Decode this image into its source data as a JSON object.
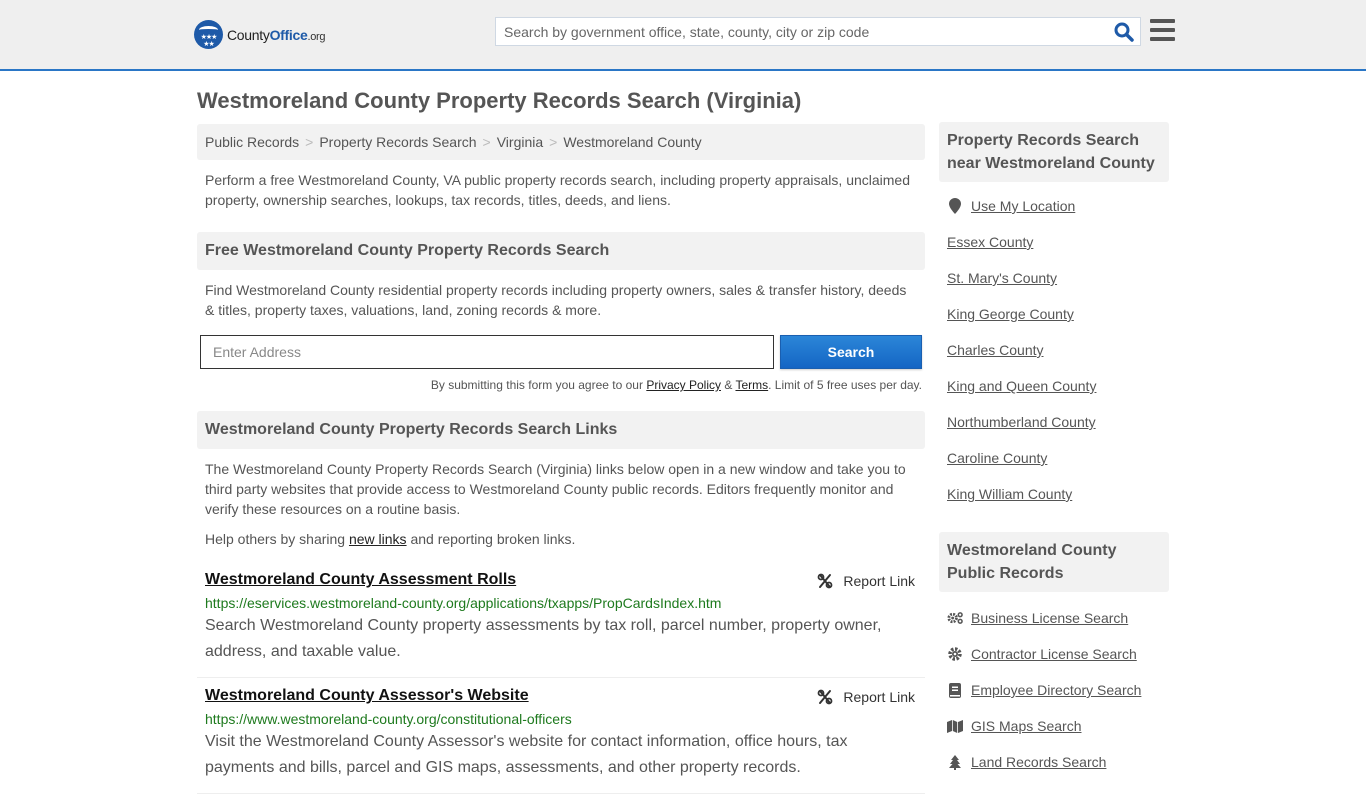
{
  "header": {
    "logo": {
      "county": "County",
      "office": "Office",
      "org": ".org"
    },
    "search_placeholder": "Search by government office, state, county, city or zip code"
  },
  "page_title": "Westmoreland County Property Records Search (Virginia)",
  "breadcrumb": [
    "Public Records",
    "Property Records Search",
    "Virginia",
    "Westmoreland County"
  ],
  "intro": "Perform a free Westmoreland County, VA public property records search, including property appraisals, unclaimed property, ownership searches, lookups, tax records, titles, deeds, and liens.",
  "free_search": {
    "heading": "Free Westmoreland County Property Records Search",
    "description": "Find Westmoreland County residential property records including property owners, sales & transfer history, deeds & titles, property taxes, valuations, land, zoning records & more.",
    "address_placeholder": "Enter Address",
    "button": "Search",
    "terms_prefix": "By submitting this form you agree to our ",
    "privacy_link": "Privacy Policy",
    "amp": " & ",
    "terms_link": "Terms",
    "terms_suffix": ". Limit of 5 free uses per day."
  },
  "links_section": {
    "heading": "Westmoreland County Property Records Search Links",
    "description": "The Westmoreland County Property Records Search (Virginia) links below open in a new window and take you to third party websites that provide access to Westmoreland County public records. Editors frequently monitor and verify these resources on a routine basis.",
    "help_prefix": "Help others by sharing ",
    "help_link": "new links",
    "help_suffix": " and reporting broken links.",
    "report_label": "Report Link",
    "items": [
      {
        "title": "Westmoreland County Assessment Rolls",
        "url": "https://eservices.westmoreland-county.org/applications/txapps/PropCardsIndex.htm",
        "description": "Search Westmoreland County property assessments by tax roll, parcel number, property owner, address, and taxable value."
      },
      {
        "title": "Westmoreland County Assessor's Website",
        "url": "https://www.westmoreland-county.org/constitutional-officers",
        "description": "Visit the Westmoreland County Assessor's website for contact information, office hours, tax payments and bills, parcel and GIS maps, assessments, and other property records."
      }
    ]
  },
  "sidebar": {
    "nearby": {
      "heading": "Property Records Search near Westmoreland County",
      "use_location": "Use My Location",
      "items": [
        "Essex County",
        "St. Mary's County",
        "King George County",
        "Charles County",
        "King and Queen County",
        "Northumberland County",
        "Caroline County",
        "King William County"
      ]
    },
    "public_records": {
      "heading": "Westmoreland County Public Records",
      "items": [
        {
          "label": "Business License Search",
          "icon": "gears-icon"
        },
        {
          "label": "Contractor License Search",
          "icon": "gear-icon"
        },
        {
          "label": "Employee Directory Search",
          "icon": "book-icon"
        },
        {
          "label": "GIS Maps Search",
          "icon": "map-icon"
        },
        {
          "label": "Land Records Search",
          "icon": "tree-icon"
        }
      ]
    }
  },
  "colors": {
    "accent": "#2a76c6",
    "button": "#1a6fcd",
    "url_green": "#1e7a1e"
  }
}
